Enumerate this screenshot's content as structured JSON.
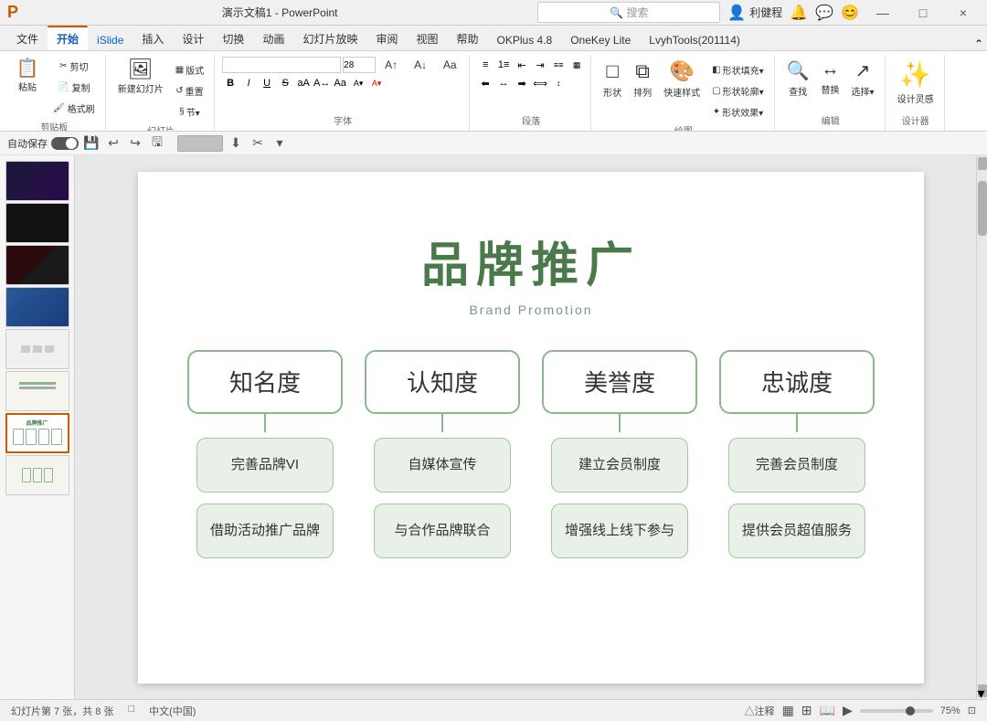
{
  "titleBar": {
    "filename": "演示文稿1 - PowerPoint",
    "searchPlaceholder": "搜索",
    "username": "利健程",
    "winBtns": [
      "—",
      "□",
      "×"
    ]
  },
  "ribbonTabs": [
    {
      "label": "文件",
      "active": false
    },
    {
      "label": "开始",
      "active": true
    },
    {
      "label": "iSlide",
      "active": false,
      "special": true
    },
    {
      "label": "插入",
      "active": false
    },
    {
      "label": "设计",
      "active": false
    },
    {
      "label": "切换",
      "active": false
    },
    {
      "label": "动画",
      "active": false
    },
    {
      "label": "幻灯片放映",
      "active": false
    },
    {
      "label": "审阅",
      "active": false
    },
    {
      "label": "视图",
      "active": false
    },
    {
      "label": "帮助",
      "active": false
    },
    {
      "label": "OKPlus 4.8",
      "active": false
    },
    {
      "label": "OneKey Lite",
      "active": false
    },
    {
      "label": "LvyhTools(201114)",
      "active": false
    }
  ],
  "quickAccess": {
    "autosave": "自动保存",
    "buttons": [
      "💾",
      "↩",
      "↪",
      "🖫"
    ]
  },
  "slides": [
    {
      "num": 1,
      "type": "dark-purple"
    },
    {
      "num": 2,
      "type": "dark"
    },
    {
      "num": 3,
      "type": "dark-red"
    },
    {
      "num": 4,
      "type": "blue"
    },
    {
      "num": 5,
      "type": "light"
    },
    {
      "num": 6,
      "type": "light-green"
    },
    {
      "num": 7,
      "type": "current",
      "active": true
    },
    {
      "num": 8,
      "type": "light-green-2"
    }
  ],
  "slide": {
    "title": "品牌推广",
    "subtitle": "Brand  Promotion",
    "columns": [
      {
        "header": "知名度",
        "items": [
          "完善品牌VI",
          "借助活动推广品牌"
        ]
      },
      {
        "header": "认知度",
        "items": [
          "自媒体宣传",
          "与合作品牌联合"
        ]
      },
      {
        "header": "美誉度",
        "items": [
          "建立会员制度",
          "增强线上线下参与"
        ]
      },
      {
        "header": "忠诚度",
        "items": [
          "完善会员制度",
          "提供会员超值服务"
        ]
      }
    ]
  },
  "statusBar": {
    "slideInfo": "幻灯片第 7 张，共 8 张",
    "lang": "中文(中国)",
    "accessibility": "△注释",
    "zoom": "75%"
  },
  "ribbon": {
    "groups": [
      {
        "label": "剪贴板",
        "buttons": [
          {
            "icon": "📋",
            "label": "粘贴"
          },
          {
            "icon": "✂",
            "label": "剪切"
          },
          {
            "icon": "📄",
            "label": "复制"
          },
          {
            "icon": "🖌",
            "label": "格式"
          }
        ]
      },
      {
        "label": "幻灯片",
        "buttons": [
          {
            "icon": "＋",
            "label": "新建幻灯片"
          },
          {
            "icon": "≡",
            "label": "版式"
          },
          {
            "icon": "↺",
            "label": "重置"
          },
          {
            "icon": "§",
            "label": "节"
          }
        ]
      },
      {
        "label": "字体"
      },
      {
        "label": "段落"
      },
      {
        "label": "绘图",
        "buttons": [
          {
            "icon": "□",
            "label": "形状"
          },
          {
            "icon": "☰",
            "label": "排列"
          },
          {
            "icon": "🎨",
            "label": "快速样式"
          }
        ]
      },
      {
        "label": "编辑",
        "buttons": [
          {
            "icon": "🔍",
            "label": "查找"
          },
          {
            "icon": "↔",
            "label": "替换"
          },
          {
            "icon": "→",
            "label": "选择"
          }
        ]
      },
      {
        "label": "设计器",
        "buttons": [
          {
            "icon": "✨",
            "label": "设计灵感"
          }
        ]
      }
    ]
  }
}
